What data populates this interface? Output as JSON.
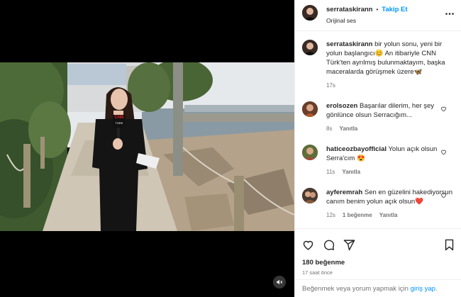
{
  "post": {
    "username": "serrataskirann",
    "separator": "•",
    "follow_label": "Takip Et",
    "audio_label": "Orijinal ses",
    "caption": {
      "username": "serrataskirann",
      "text": "bir yolun sonu, yeni bir yolun başlangıcı😊 An itibariyle CNN Türk'ten ayrılmış bulunmaktayım, başka maceralarda görüşmek üzere🦋",
      "age": "17s"
    }
  },
  "comments": [
    {
      "username": "erolsozen",
      "text": "Başarılar dilerim, her şey gönlünce olsun Serracığım...",
      "age": "8s",
      "reply_label": "Yanıtla"
    },
    {
      "username": "haticeozbayofficial",
      "text": "Yolun açık olsun Serra'cım 😍",
      "age": "11s",
      "reply_label": "Yanıtla"
    },
    {
      "username": "ayferemrah",
      "text": "Sen en güzelini hakediyorsun canım benim yolun açık olsun❤️",
      "age": "12s",
      "likes_label": "1 beğenme",
      "reply_label": "Yanıtla"
    }
  ],
  "actions": {
    "likes": "180 beğenme",
    "time": "17 saat önce"
  },
  "login": {
    "prefix": "Beğenmek veya yorum yapmak için ",
    "link": "giriş yap",
    "suffix": "."
  },
  "video": {
    "logo_text": "CNN",
    "logo_sub": "TÜRK"
  },
  "icons": {
    "more": "more-icon",
    "heart": "heart-icon",
    "comment": "comment-icon",
    "share": "share-icon",
    "save": "bookmark-icon",
    "mute": "speaker-icon"
  }
}
